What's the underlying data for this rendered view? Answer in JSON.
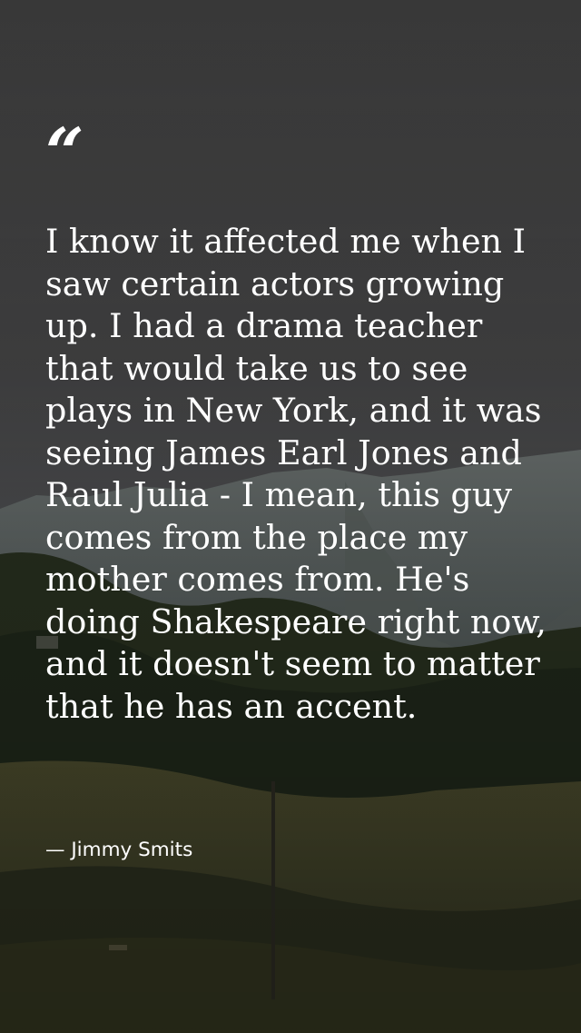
{
  "quote": {
    "mark": "“",
    "text": "I know it affected me when I saw certain actors growing up. I had a drama teacher that would take us to see plays in New York, and it was seeing James Earl Jones and Raul Julia - I mean, this guy comes from the place my mother comes from. He's doing Shakespeare right now, and it doesn't seem to matter that he has an accent.",
    "author": "— Jimmy Smits"
  },
  "colors": {
    "text": "#ffffff",
    "overlay": "#3c3c3c",
    "sky": "#4a4a4a",
    "mountain": "#5c6462",
    "forest": "#27301f",
    "field": "#4e4a2c"
  }
}
